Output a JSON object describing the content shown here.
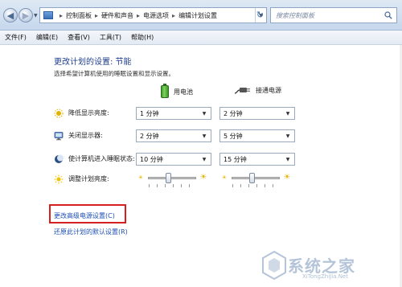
{
  "address_bar": {
    "breadcrumbs": [
      "控制面板",
      "硬件和声音",
      "电源选项",
      "编辑计划设置"
    ],
    "search_placeholder": "搜索控制面板"
  },
  "menu": {
    "items": [
      "文件(F)",
      "编辑(E)",
      "查看(V)",
      "工具(T)",
      "帮助(H)"
    ]
  },
  "main": {
    "title": "更改计划的设置: 节能",
    "subtitle": "选择希望计算机使用的睡眠设置和显示设置。",
    "columns": {
      "battery": "用电池",
      "plugged_in": "接通电源"
    },
    "rows": [
      {
        "label": "降低显示亮度:",
        "icon": "dim-display-icon",
        "battery": "1 分钟",
        "plugged": "2 分钟"
      },
      {
        "label": "关闭显示器:",
        "icon": "monitor-icon",
        "battery": "2 分钟",
        "plugged": "5 分钟"
      },
      {
        "label": "使计算机进入睡眠状态:",
        "icon": "sleep-moon-icon",
        "battery": "10 分钟",
        "plugged": "15 分钟"
      }
    ],
    "brightness": {
      "label": "调整计划亮度:",
      "battery_level": 0.4,
      "plugged_level": 0.4
    },
    "links": {
      "advanced": "更改高级电源设置(C)",
      "restore": "还原此计划的默认设置(R)"
    }
  },
  "watermark": {
    "text": "系统之家",
    "url": "XiTongZhiJia.Net"
  },
  "colors": {
    "title_blue": "#1e3e8c",
    "link_blue": "#1e4fb0",
    "highlight_red": "#d62020"
  }
}
